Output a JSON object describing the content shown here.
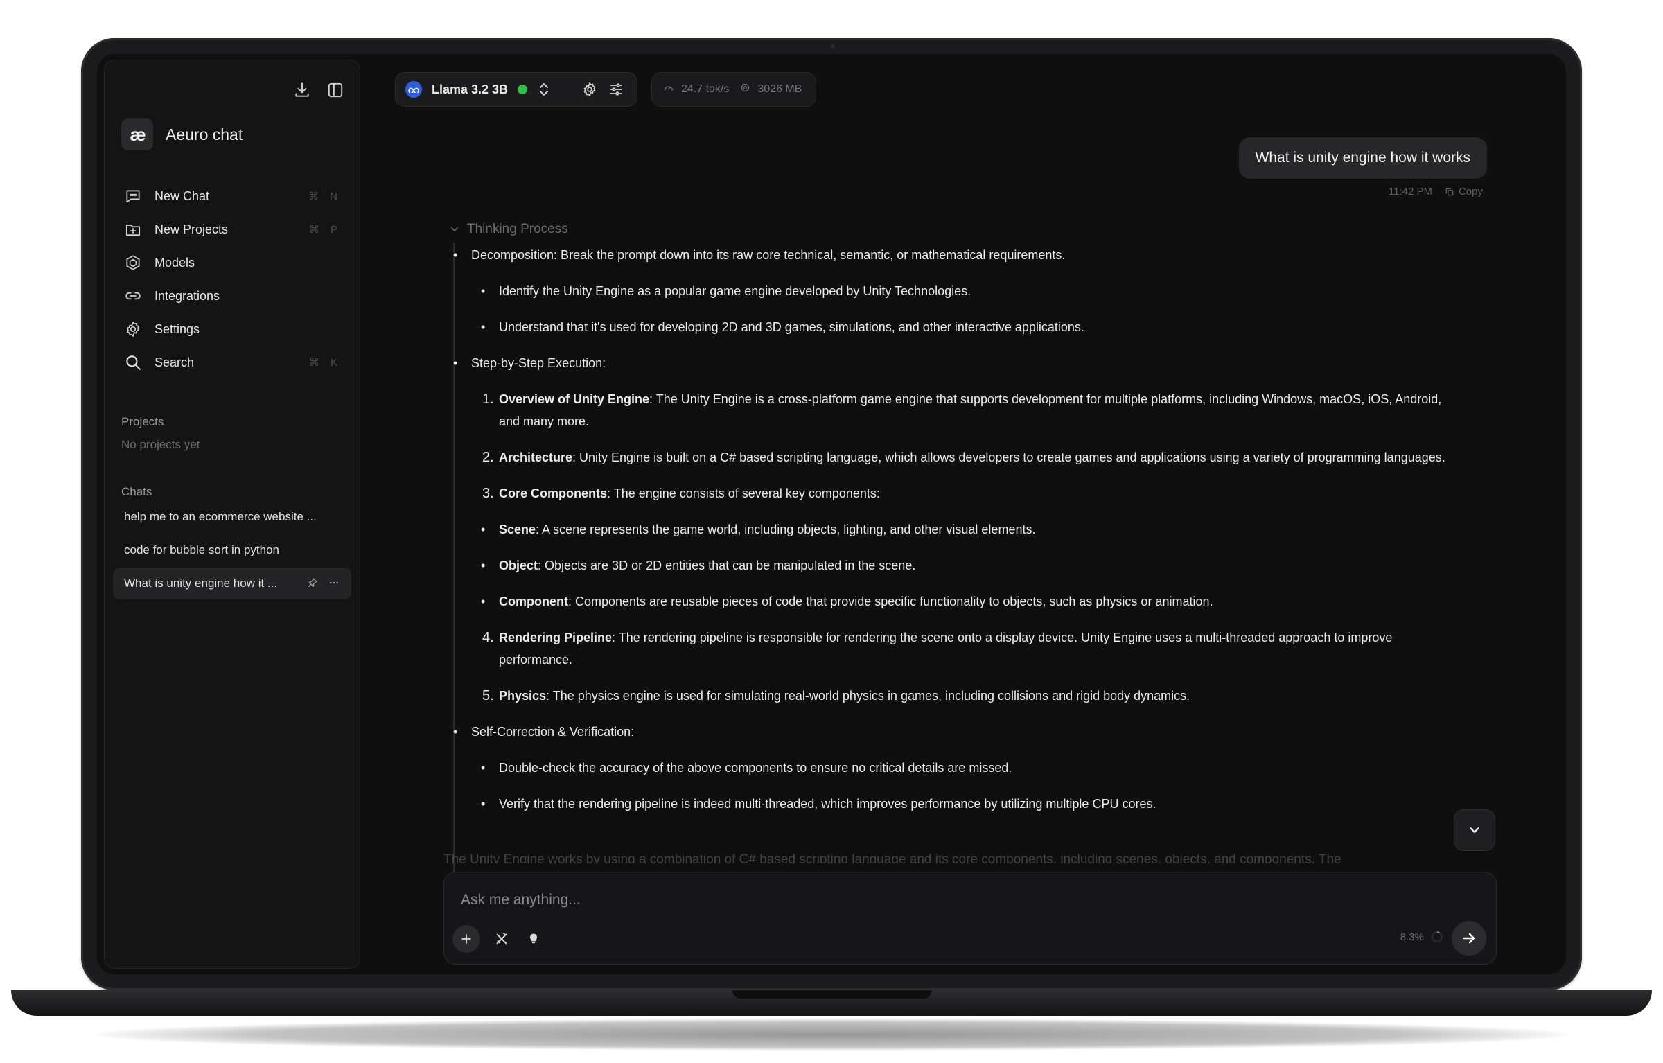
{
  "sidebar": {
    "brand": {
      "logo_text": "æ",
      "name": "Aeuro chat"
    },
    "nav": [
      {
        "label": "New Chat",
        "shortcut": "⌘ N",
        "icon": "chat-bubble-icon"
      },
      {
        "label": "New Projects",
        "shortcut": "⌘ P",
        "icon": "folder-plus-icon"
      },
      {
        "label": "Models",
        "shortcut": "",
        "icon": "models-icon"
      },
      {
        "label": "Integrations",
        "shortcut": "",
        "icon": "link-icon"
      },
      {
        "label": "Settings",
        "shortcut": "",
        "icon": "gear-icon"
      },
      {
        "label": "Search",
        "shortcut": "⌘ K",
        "icon": "search-icon"
      }
    ],
    "projects_title": "Projects",
    "projects_empty": "No projects yet",
    "chats_title": "Chats",
    "chats": [
      {
        "title": "help me to an ecommerce website ..."
      },
      {
        "title": "code for bubble sort in python"
      },
      {
        "title": "What is unity engine how it ..."
      }
    ]
  },
  "topbar": {
    "model_name": "Llama 3.2 3B",
    "status_color": "#2fbf4a",
    "speed": "24.7 tok/s",
    "memory": "3026 MB"
  },
  "conversation": {
    "user_message": "What is unity engine how it works",
    "timestamp": "11:42 PM",
    "copy_label": "Copy",
    "thinking_label": "Thinking Process",
    "thinking": {
      "l1": "Decomposition: Break the prompt down into its raw core technical, semantic, or mathematical requirements.",
      "l2": "Identify the Unity Engine as a popular game engine developed by Unity Technologies.",
      "l3": "Understand that it's used for developing 2D and 3D games, simulations, and other interactive applications.",
      "l4": "Step-by-Step Execution:",
      "n1_title": "Overview of Unity Engine",
      "n1_text": ": The Unity Engine is a cross-platform game engine that supports development for multiple platforms, including Windows, macOS, iOS, Android, and many more.",
      "n2_title": "Architecture",
      "n2_text": ": Unity Engine is built on a C# based scripting language, which allows developers to create games and applications using a variety of programming languages.",
      "n3_title": "Core Components",
      "n3_text": ": The engine consists of several key components:",
      "c1_title": "Scene",
      "c1_text": ": A scene represents the game world, including objects, lighting, and other visual elements.",
      "c2_title": "Object",
      "c2_text": ": Objects are 3D or 2D entities that can be manipulated in the scene.",
      "c3_title": "Component",
      "c3_text": ": Components are reusable pieces of code that provide specific functionality to objects, such as physics or animation.",
      "n4_title": "Rendering Pipeline",
      "n4_text": ": The rendering pipeline is responsible for rendering the scene onto a display device. Unity Engine uses a multi-threaded approach to improve performance.",
      "n5_title": "Physics",
      "n5_text": ": The physics engine is used for simulating real-world physics in games, including collisions and rigid body dynamics.",
      "l5": "Self-Correction & Verification:",
      "l6": "Double-check the accuracy of the above components to ensure no critical details are missed.",
      "l7": "Verify that the rendering pipeline is indeed multi-threaded, which improves performance by utilizing multiple CPU cores."
    },
    "answer_preview": "The Unity Engine works by using a combination of C# based scripting language and its core components, including scenes, objects, and components. The"
  },
  "composer": {
    "placeholder": "Ask me anything...",
    "value": "",
    "context_usage": "8.3%"
  }
}
